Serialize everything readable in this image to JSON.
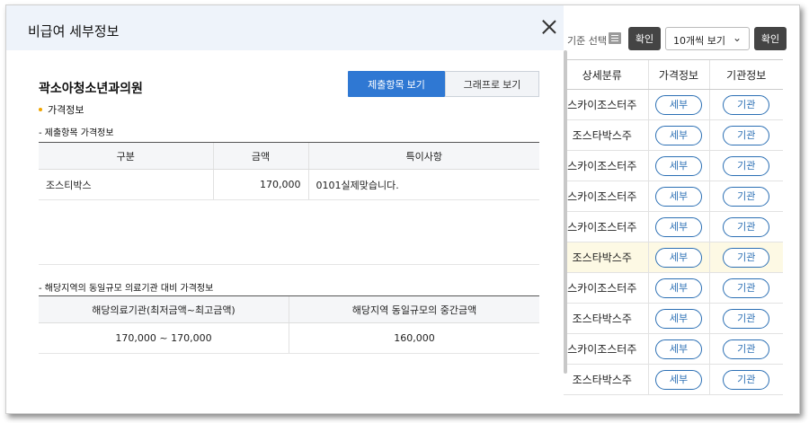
{
  "modal": {
    "title": "비급여 세부정보",
    "org_name": "곽소아청소년과의원",
    "view_items_button": "제출항목 보기",
    "view_graph_button": "그래프로 보기",
    "section_price": "가격정보",
    "submitted_price_label": "- 제출항목 가격정보",
    "submitted_table": {
      "headers": [
        "구분",
        "금액",
        "특이사항"
      ],
      "rows": [
        {
          "category": "조스티박스",
          "amount": "170,000",
          "note": "0101실제맞습니다."
        }
      ]
    },
    "regional_label": "- 해당지역의 동일규모 의료기관 대비 가격정보",
    "regional_table": {
      "headers": [
        "해당의료기관(최저금액~최고금액)",
        "해당지역 동일규모의 중간금액"
      ],
      "rows": [
        {
          "range": "170,000 ~ 170,000",
          "median": "160,000"
        }
      ]
    }
  },
  "background": {
    "filter_label": "기준 선택",
    "confirm_label": "확인",
    "page_size_select": "10개씩 보기",
    "table_headers": [
      "상세분류",
      "가격정보",
      "기관정보"
    ],
    "detail_button": "세부",
    "org_button": "기관",
    "rows": [
      {
        "name": "스카이조스터주",
        "highlight": false
      },
      {
        "name": "조스타박스주",
        "highlight": false
      },
      {
        "name": "스카이조스터주",
        "highlight": false
      },
      {
        "name": "스카이조스터주",
        "highlight": false
      },
      {
        "name": "스카이조스터주",
        "highlight": false
      },
      {
        "name": "조스타박스주",
        "highlight": true
      },
      {
        "name": "스카이조스터주",
        "highlight": false
      },
      {
        "name": "조스타박스주",
        "highlight": false
      },
      {
        "name": "스카이조스터주",
        "highlight": false
      },
      {
        "name": "조스타박스주",
        "highlight": false
      }
    ]
  },
  "colors": {
    "accent": "#2f78d3",
    "pill_border": "#2b6fb4",
    "highlight_row": "#fdf9e4",
    "bullet": "#f0a500"
  }
}
